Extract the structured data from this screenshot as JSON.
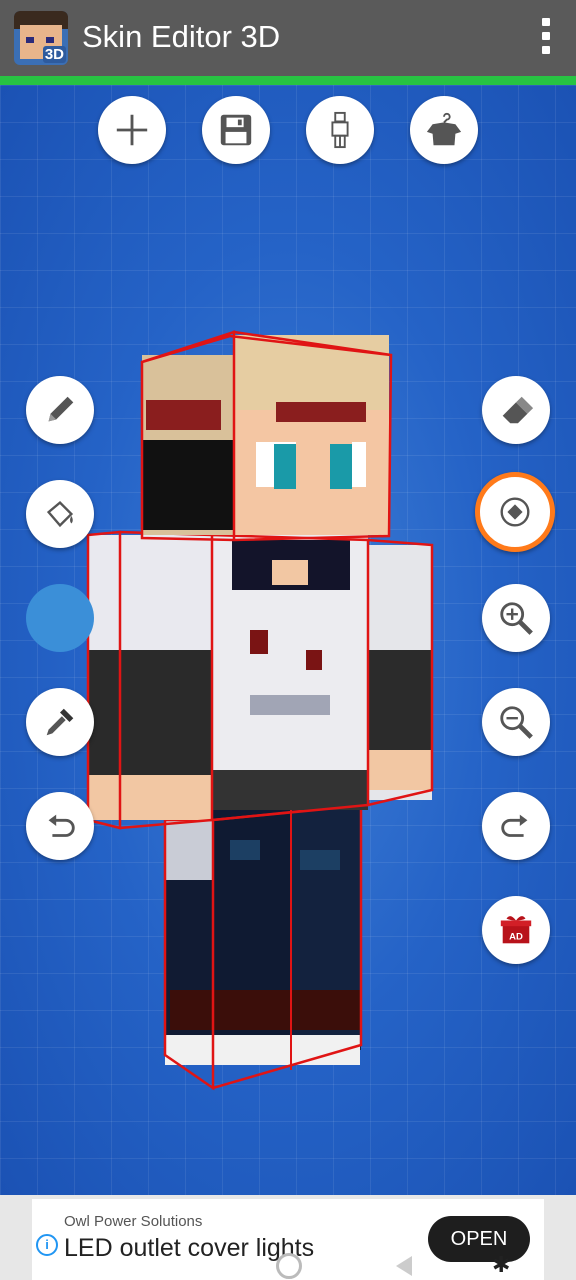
{
  "app": {
    "title": "Skin Editor 3D",
    "logo_badge": "3D",
    "accent_bar_color": "#27c343"
  },
  "toolbar_top": [
    {
      "icon": "plus-icon"
    },
    {
      "icon": "save-icon"
    },
    {
      "icon": "body-icon"
    },
    {
      "icon": "shirt-icon"
    }
  ],
  "tools_left": [
    {
      "icon": "pencil-icon"
    },
    {
      "icon": "paint-bucket-icon"
    },
    {
      "icon": "color-swatch",
      "color": "#3b8fd8"
    },
    {
      "icon": "eyedropper-icon"
    },
    {
      "icon": "undo-icon"
    }
  ],
  "tools_right": [
    {
      "icon": "eraser-icon"
    },
    {
      "icon": "rotate-reset-icon",
      "selected": true
    },
    {
      "icon": "zoom-in-icon"
    },
    {
      "icon": "zoom-out-icon"
    },
    {
      "icon": "redo-icon"
    },
    {
      "icon": "ad-gift-icon",
      "label": "AD"
    }
  ],
  "ad": {
    "sponsor": "Owl Power Solutions",
    "headline": "LED outlet cover lights",
    "cta": "OPEN",
    "info": "i"
  }
}
